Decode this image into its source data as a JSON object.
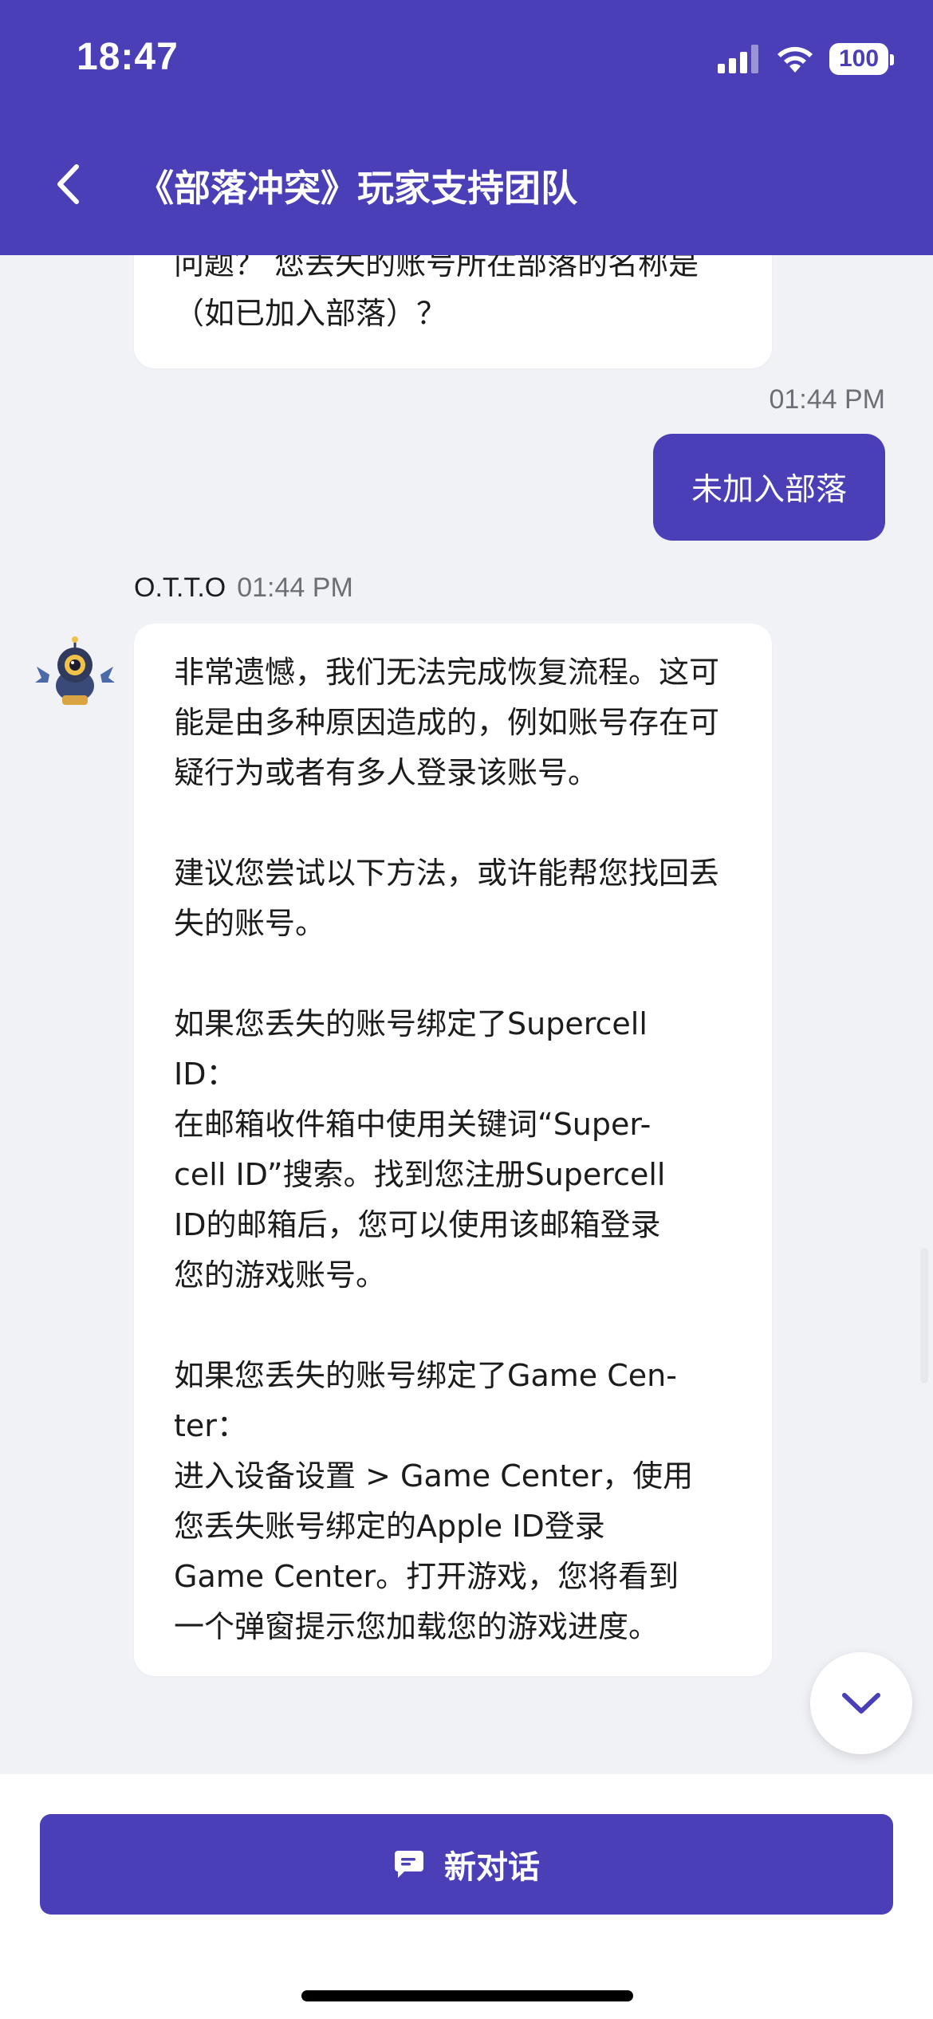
{
  "status_bar": {
    "time": "18:47",
    "battery": "100"
  },
  "header": {
    "title": "《部落冲突》玩家支持团队",
    "back_icon": "chevron-left-icon"
  },
  "chat": {
    "previous_bot_message": "问题？ 您丢失的账号所在部落的名称是（如已加入部落）？",
    "user_message": {
      "time": "01:44 PM",
      "text": "未加入部落"
    },
    "bot_message": {
      "sender": "O.T.T.O",
      "time": "01:44 PM",
      "paragraphs": [
        "非常遗憾，我们无法完成恢复流程。这可能是由多种原因造成的，例如账号存在可疑行为或者有多人登录该账号。",
        "建议您尝试以下方法，或许能帮您找回丢失的账号。",
        "如果您丢失的账号绑定了Supercell\nID：\n在邮箱收件箱中使用关键词“Super-\ncell ID”搜索。找到您注册Supercell\nID的邮箱后，您可以使用该邮箱登录\n您的游戏账号。",
        "如果您丢失的账号绑定了Game Cen-\nter：\n进入设备设置 > Game Center，使用\n您丢失账号绑定的Apple ID登录\nGame Center。打开游戏，您将看到\n一个弹窗提示您加载您的游戏进度。"
      ]
    }
  },
  "footer": {
    "new_chat_label": "新对话",
    "new_chat_icon": "chat-bubble-icon"
  },
  "colors": {
    "accent": "#4a3fb6",
    "background": "#f1f2f6",
    "bubble": "#ffffff"
  }
}
